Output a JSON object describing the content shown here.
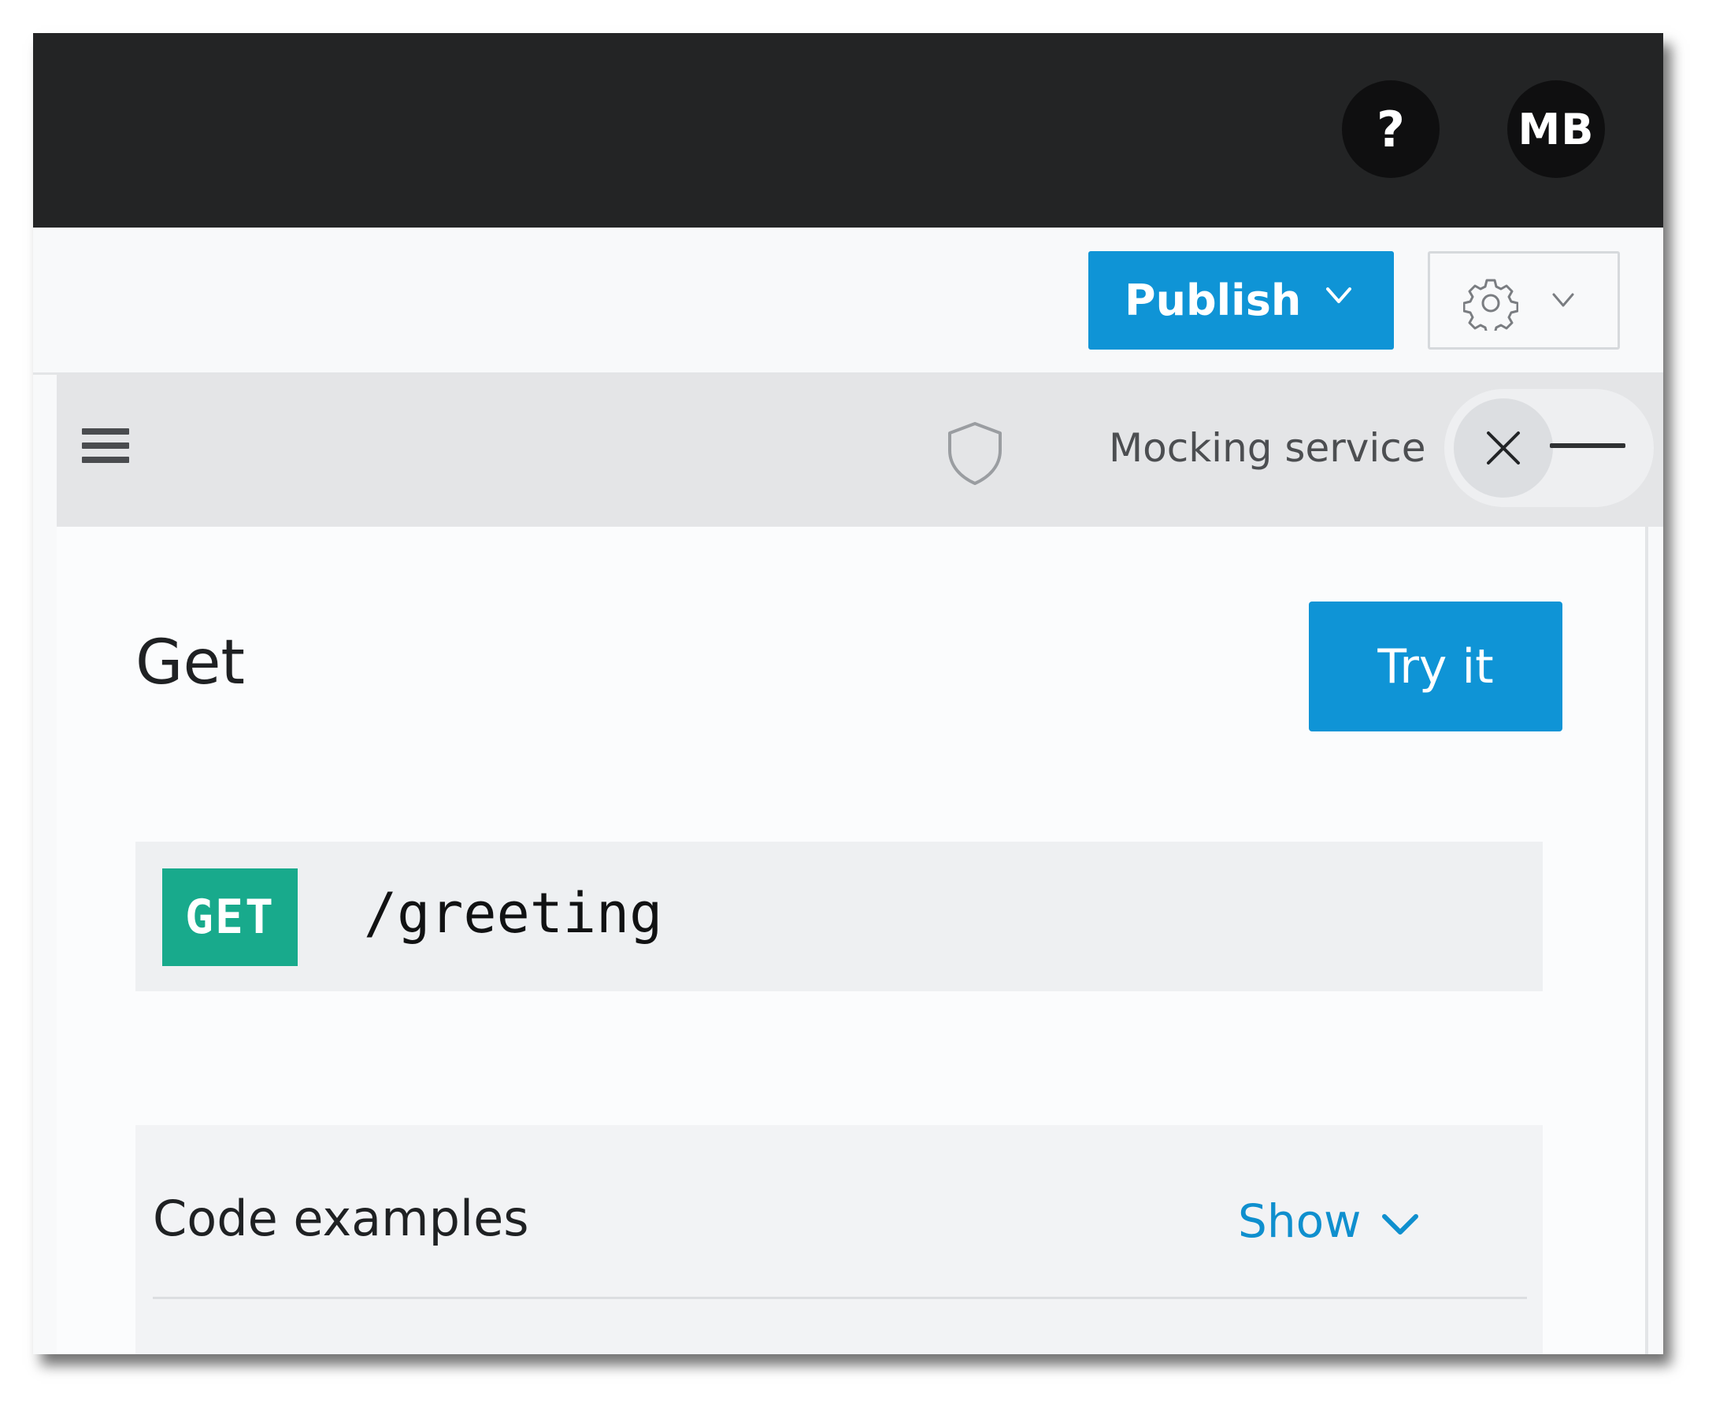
{
  "topbar": {
    "help_label": "?",
    "avatar_initials": "MB"
  },
  "toolbar": {
    "publish_label": "Publish",
    "settings_icon": "gear-icon"
  },
  "panel_header": {
    "menu_icon": "hamburger-icon",
    "security_icon": "shield-icon",
    "mocking_label": "Mocking service",
    "mocking_toggle_on": false
  },
  "operation": {
    "title": "Get",
    "try_label": "Try it",
    "method": "GET",
    "path": "/greeting"
  },
  "code_examples": {
    "title": "Code examples",
    "toggle_label": "Show"
  },
  "colors": {
    "accent": "#0f94d6",
    "method_get": "#18aa8c",
    "topbar": "#232425"
  }
}
